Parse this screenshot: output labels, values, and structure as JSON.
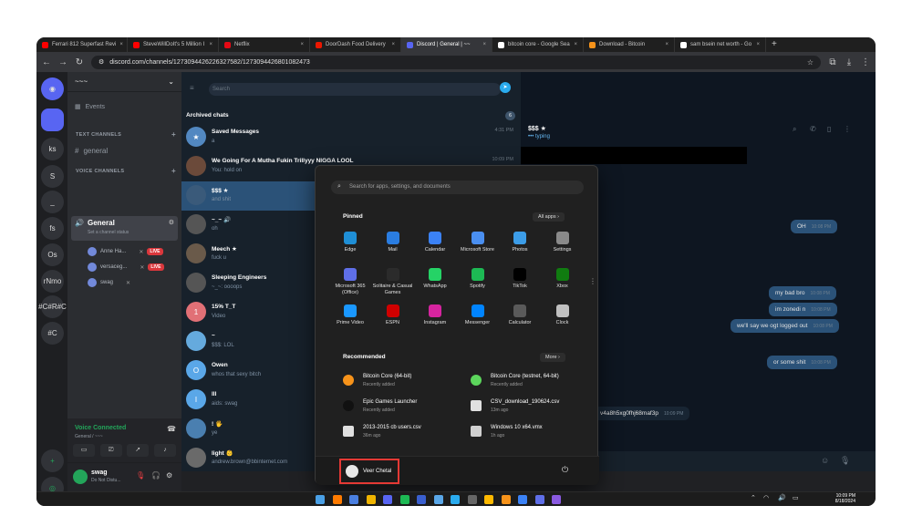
{
  "browser": {
    "tabs": [
      {
        "label": "Ferrari 812 Superfast Revi",
        "color": "#ff0000"
      },
      {
        "label": "SteveWillDoIt's 5 Million I",
        "color": "#ff0000"
      },
      {
        "label": "Netflix",
        "color": "#e50914"
      },
      {
        "label": "DoorDash Food Delivery",
        "color": "#eb1700"
      },
      {
        "label": "Discord | General | ~~",
        "color": "#5865f2"
      },
      {
        "label": "bitcoin core - Google Sea",
        "color": "#ffffff"
      },
      {
        "label": "Download - Bitcoin",
        "color": "#f7931a"
      },
      {
        "label": "sam bsein net worth - Go",
        "color": "#ffffff"
      }
    ],
    "url": "discord.com/channels/1273094426226327582/1273094426801082473"
  },
  "discord": {
    "guilds": [
      "ks",
      "S",
      "_",
      "fs",
      "Os",
      "rNmo",
      "#C#R#C",
      "#C"
    ],
    "server_name": "~~~",
    "events_label": "Events",
    "text_channels_label": "TEXT CHANNELS",
    "general_text": "general",
    "voice_channels_label": "VOICE CHANNELS",
    "voice_channel": "General",
    "voice_status": "Set a channel status",
    "voice_users": [
      {
        "name": "Anne Ha...",
        "live": "LIVE"
      },
      {
        "name": "versaceg...",
        "live": "LIVE"
      },
      {
        "name": "swag",
        "live": ""
      }
    ],
    "voice_connected": "Voice Connected",
    "voice_connected_sub": "General / ~~~",
    "user_name": "swag",
    "user_status": "Do Not Distu..."
  },
  "telegram": {
    "search_placeholder": "Search",
    "archived_label": "Archived chats",
    "archived_count": "6",
    "chats": [
      {
        "name": "Saved Messages",
        "preview": "a",
        "time": "4:31 PM",
        "avatar": "★"
      },
      {
        "name": "We Going For A Mutha Fukin Trillyyy NIGGA LOOL",
        "preview": "You: hold on",
        "time": "10:09 PM",
        "avatar": ""
      },
      {
        "name": "$$$ ★",
        "preview": "and shit",
        "time": "",
        "avatar": ""
      },
      {
        "name": "~_~ 🔊",
        "preview": "oh",
        "time": "",
        "avatar": ""
      },
      {
        "name": "Meech ★",
        "preview": "fuck u",
        "time": "",
        "avatar": ""
      },
      {
        "name": "Sleeping Engineers",
        "preview": "~_~: oooops",
        "time": "",
        "avatar": ""
      },
      {
        "name": "15% T_T",
        "preview": "Video",
        "time": "",
        "avatar": "1"
      },
      {
        "name": "~",
        "preview": "$$$: LOL",
        "time": "",
        "avatar": ""
      },
      {
        "name": "Owen",
        "preview": "whos that sexy bitch",
        "time": "",
        "avatar": "O"
      },
      {
        "name": "lll",
        "preview": "aids: swag",
        "time": "",
        "avatar": "I"
      },
      {
        "name": "! 🖐",
        "preview": "ye",
        "time": "",
        "avatar": ""
      },
      {
        "name": "light 👶",
        "preview": "andrew.brown@bbinternet.com",
        "time": "",
        "avatar": ""
      }
    ],
    "conv_title": "$$$ ★",
    "conv_status": "••• typing",
    "messages": [
      {
        "text": "send him it",
        "time": "10:08 PM",
        "dir": "in"
      },
      {
        "text": "what?",
        "time": "10:08 PM",
        "dir": "in"
      },
      {
        "text": "OH",
        "time": "10:08 PM",
        "dir": "out"
      },
      {
        "text": "my bad bro",
        "time": "10:08 PM",
        "dir": "out"
      },
      {
        "text": "im zonedi n",
        "time": "10:08 PM",
        "dir": "out"
      },
      {
        "text": "we'll say we ogt logged out",
        "time": "10:08 PM",
        "dir": "out"
      },
      {
        "text": "or some shit",
        "time": "10:08 PM",
        "dir": "out"
      },
      {
        "text": "v4a8h5xg0fhj68maf3p",
        "time": "10:09 PM",
        "dir": "in"
      }
    ]
  },
  "start_menu": {
    "search_placeholder": "Search for apps, settings, and documents",
    "pinned_label": "Pinned",
    "all_apps_label": "All apps",
    "pinned": [
      {
        "label": "Edge",
        "color": "#1f8fd6"
      },
      {
        "label": "Mail",
        "color": "#2a7de1"
      },
      {
        "label": "Calendar",
        "color": "#3b82f6"
      },
      {
        "label": "Microsoft Store",
        "color": "#4a8ff0"
      },
      {
        "label": "Photos",
        "color": "#3c9de8"
      },
      {
        "label": "Settings",
        "color": "#8a8a8a"
      },
      {
        "label": "Microsoft 365 (Office)",
        "color": "#5f6fe8"
      },
      {
        "label": "Solitaire & Casual Games",
        "color": "#2b2b2b"
      },
      {
        "label": "WhatsApp",
        "color": "#25d366"
      },
      {
        "label": "Spotify",
        "color": "#1db954"
      },
      {
        "label": "TikTok",
        "color": "#000000"
      },
      {
        "label": "Xbox",
        "color": "#107c10"
      },
      {
        "label": "Prime Video",
        "color": "#1a98ff"
      },
      {
        "label": "ESPN",
        "color": "#d00000"
      },
      {
        "label": "Instagram",
        "color": "#d6249f"
      },
      {
        "label": "Messenger",
        "color": "#0084ff"
      },
      {
        "label": "Calculator",
        "color": "#5a5a5a"
      },
      {
        "label": "Clock",
        "color": "#c0c0c0"
      }
    ],
    "recommended_label": "Recommended",
    "more_label": "More",
    "recommended": [
      {
        "name": "Bitcoin Core (64-bit)",
        "sub": "Recently added",
        "color": "#f7931a"
      },
      {
        "name": "Bitcoin Core (testnet, 64-bit)",
        "sub": "Recently added",
        "color": "#5cd65c"
      },
      {
        "name": "Epic Games Launcher",
        "sub": "Recently added",
        "color": "#111111"
      },
      {
        "name": "CSV_download_190624.csv",
        "sub": "13m ago",
        "color": "#e0e0e0"
      },
      {
        "name": "2013-2015 cb users.csv",
        "sub": "36m ago",
        "color": "#e0e0e0"
      },
      {
        "name": "Windows 10 x64.vmx",
        "sub": "1h ago",
        "color": "#d0d0d0"
      }
    ],
    "user_name": "Veer Chetal"
  },
  "taskbar": {
    "time": "10:09 PM",
    "date": "8/18/2024"
  }
}
